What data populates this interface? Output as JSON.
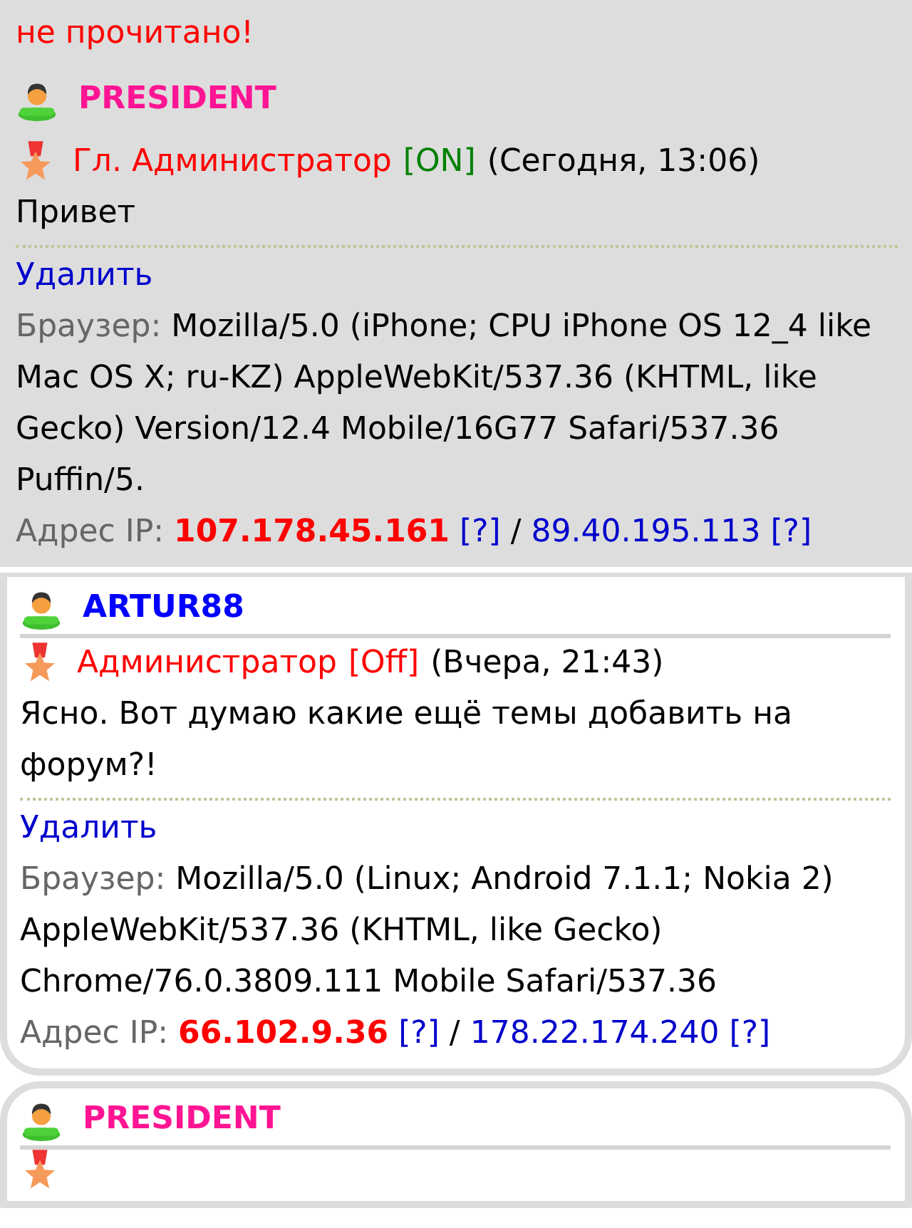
{
  "unread_notice": "не прочитано!",
  "posts": [
    {
      "kind": "highlighted",
      "author": "PRESIDENT",
      "color": "#ff1493",
      "rank": "Гл. Администратор",
      "online": true,
      "status": "[ON]",
      "time": "(Сегодня, 13:06)",
      "message": "Привет",
      "delete": "Удалить",
      "browser_label": "Браузер:",
      "browser": "Mozilla/5.0 (iPhone; CPU iPhone OS 12_4 like Mac OS X; ru-KZ) AppleWebKit/537.36 (KHTML, like Gecko) Version/12.4 Mobile/16G77 Safari/537.36 Puffin/5.",
      "ip_label": "Адрес IP:",
      "ip": "107.178.45.161",
      "ip_help": "[?]",
      "separator": "/",
      "ip2": "89.40.195.113",
      "ip2_help": "[?]"
    },
    {
      "kind": "card",
      "author": "ARTUR88",
      "color": "#0000ff",
      "rank": "Администратор",
      "online": false,
      "status": "[Off]",
      "time": "(Вчера, 21:43)",
      "message": "Ясно. Вот думаю какие ещё темы добавить на форум?!",
      "delete": "Удалить",
      "browser_label": "Браузер:",
      "browser": "Mozilla/5.0 (Linux; Android 7.1.1; Nokia 2) AppleWebKit/537.36 (KHTML, like Gecko) Chrome/76.0.3809.111 Mobile Safari/537.36",
      "ip_label": "Адрес IP:",
      "ip": "66.102.9.36",
      "ip_help": "[?]",
      "separator": "/",
      "ip2": "178.22.174.240",
      "ip2_help": "[?]"
    },
    {
      "kind": "card",
      "author": "PRESIDENT",
      "color": "#ff1493"
    }
  ]
}
